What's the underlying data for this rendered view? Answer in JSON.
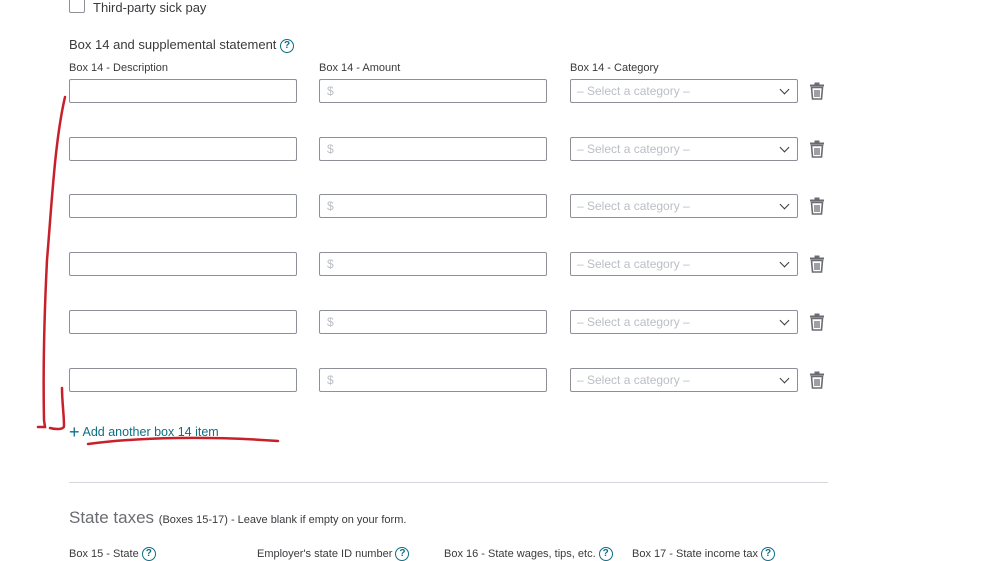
{
  "third_party_sick_pay_label": "Third-party sick pay",
  "box14": {
    "section_title": "Box 14 and supplemental statement",
    "col_description": "Box 14 - Description",
    "col_amount": "Box 14 - Amount",
    "col_category": "Box 14 - Category",
    "amount_placeholder": "$",
    "category_placeholder": "– Select a category –",
    "rows": [
      {
        "description": "",
        "amount": "",
        "category": ""
      },
      {
        "description": "",
        "amount": "",
        "category": ""
      },
      {
        "description": "",
        "amount": "",
        "category": ""
      },
      {
        "description": "",
        "amount": "",
        "category": ""
      },
      {
        "description": "",
        "amount": "",
        "category": ""
      },
      {
        "description": "",
        "amount": "",
        "category": ""
      }
    ],
    "add_item_label": "Add another box 14 item"
  },
  "state_taxes": {
    "title": "State taxes",
    "subtitle": "(Boxes 15-17) - Leave blank if empty on your form.",
    "box15_label": "Box 15 - State",
    "employer_id_label": "Employer's state ID number",
    "box16_label": "Box 16 - State wages, tips, etc.",
    "box17_label": "Box 17 - State income tax"
  },
  "colors": {
    "link": "#0d6e86",
    "annotation": "#c8202a",
    "border": "#8d9096"
  },
  "icons": [
    "help-icon",
    "trash-icon",
    "chevron-down-icon",
    "plus-icon"
  ]
}
